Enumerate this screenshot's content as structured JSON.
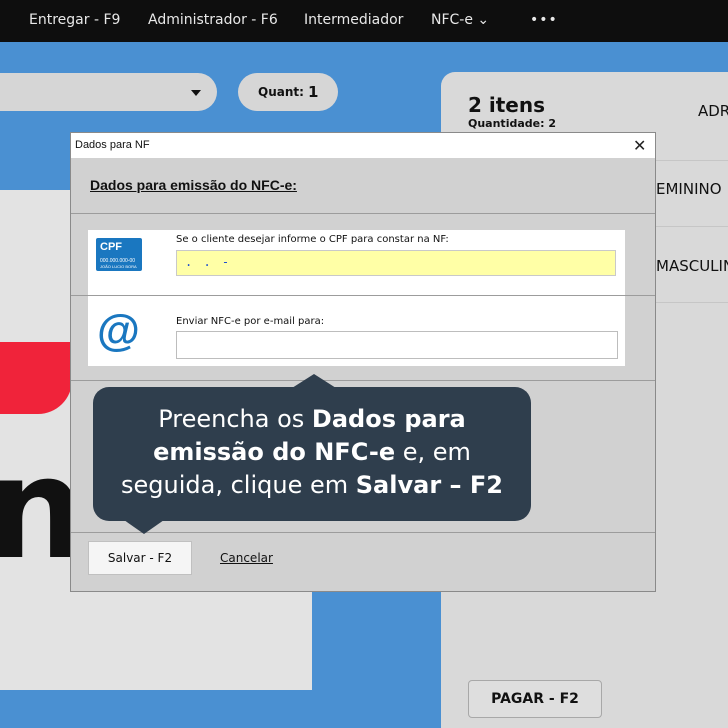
{
  "topbar": {
    "items": [
      "Entregar - F9",
      "Administrador - F6",
      "Intermediador",
      "NFC-e",
      "•••"
    ]
  },
  "order": {
    "quant_label": "Quant:",
    "quant_value": "1"
  },
  "summary": {
    "items_title": "2 itens",
    "quantity_label": "Quantidade: 2",
    "col_header_partial": "ADR",
    "rows": [
      "EMININO",
      "MASCULIN"
    ],
    "pay_button": "PAGAR - F2"
  },
  "dialog": {
    "title": "Dados para NF",
    "heading": "Dados para emissão do NFC-e:",
    "cpf": {
      "icon_text": "CPF",
      "icon_number": "000.000.000-00",
      "icon_name": "JOÃO LUCIO BORA",
      "label": "Se o cliente desejar informe o CPF para constar na NF:",
      "value": ".   .   -"
    },
    "email": {
      "label": "Enviar NFC-e por e-mail para:",
      "value": ""
    },
    "save_label": "Salvar - F2",
    "cancel_label": "Cancelar"
  },
  "tooltip": {
    "part1": "Preencha os ",
    "bold1": "Dados para emissão do NFC-e",
    "part2": " e, em seguida, clique em ",
    "bold2": "Salvar – F2"
  },
  "colors": {
    "accent_blue": "#4a90d2",
    "topbar": "#0e0e0e",
    "cpf_field": "#ffffa6",
    "tooltip_bg": "#2f3e4d",
    "brand_red": "#f0233a"
  }
}
